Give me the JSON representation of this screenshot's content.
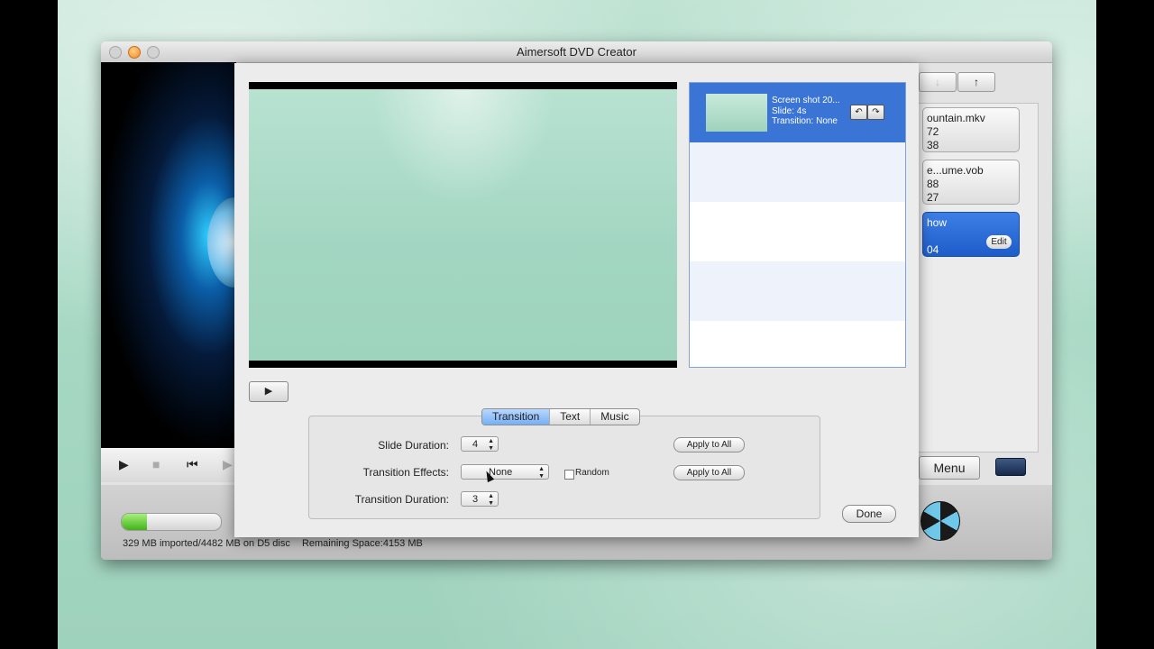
{
  "window": {
    "title": "Aimersoft DVD Creator"
  },
  "player_controls": {
    "play": "▶",
    "stop": "■",
    "prev": "⏮",
    "next": "▶"
  },
  "status": {
    "progress_fraction": 0.25,
    "imported": "329 MB imported/4482 MB on D5 disc",
    "remaining": "Remaining Space:4153 MB"
  },
  "file_list": {
    "nav_up": "↑",
    "nav_down": "↓",
    "items": [
      {
        "name": "ountain.mkv",
        "line2": "72",
        "line3": "38"
      },
      {
        "name": "e...ume.vob",
        "line2": "88",
        "line3": "27"
      },
      {
        "name": "how",
        "line2": "",
        "line3": "04",
        "edit": "Edit"
      }
    ]
  },
  "menu_button": "Menu",
  "dialog": {
    "play_button": "▶",
    "slide": {
      "name": "Screen shot 20...",
      "duration": "Slide: 4s",
      "transition": "Transition: None",
      "rotate_left": "↶",
      "rotate_right": "↷"
    },
    "tabs": [
      "Transition",
      "Text",
      "Music"
    ],
    "slide_duration": {
      "label": "Slide Duration:",
      "value": "4",
      "apply": "Apply to All"
    },
    "transition_effects": {
      "label": "Transition Effects:",
      "value": "None",
      "random": "Random",
      "apply": "Apply to All"
    },
    "transition_duration": {
      "label": "Transition Duration:",
      "value": "3"
    },
    "done": "Done"
  }
}
